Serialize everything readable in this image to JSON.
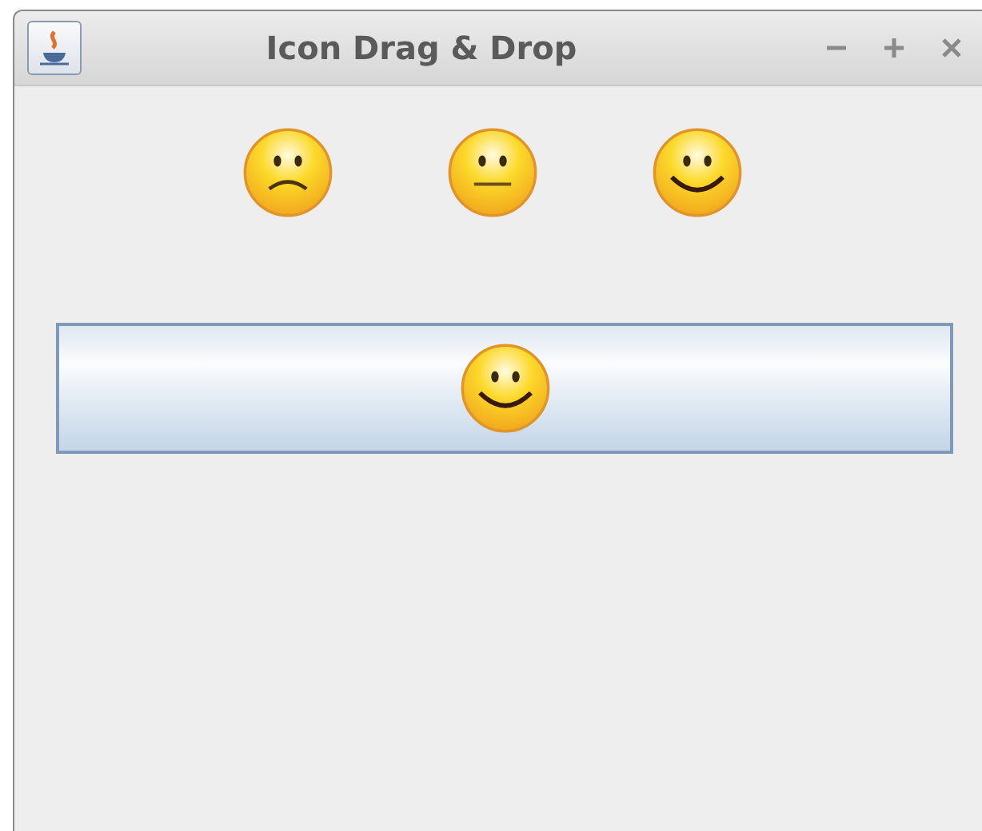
{
  "window": {
    "title": "Icon Drag & Drop"
  },
  "faces": [
    {
      "kind": "sad"
    },
    {
      "kind": "neutral"
    },
    {
      "kind": "happy"
    }
  ],
  "drop_button": {
    "kind": "happy"
  }
}
